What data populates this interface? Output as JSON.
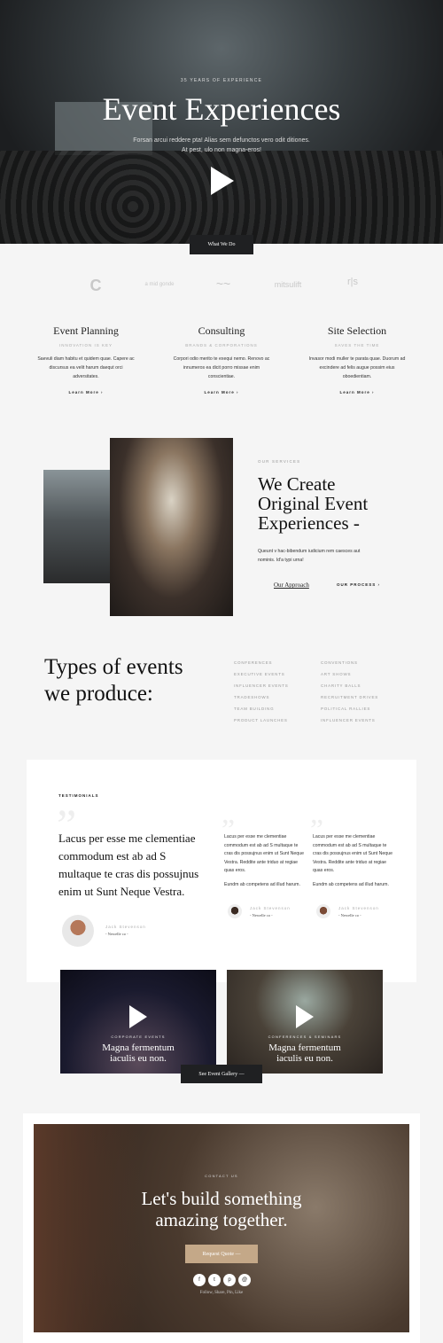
{
  "hero": {
    "eyebrow": "35 Years of Experience",
    "title": "Event Experiences",
    "subtitle_1": "Forsan arcui reddere pta! Alias sem defunctos vero odit ditiones.",
    "subtitle_2": "At pest, ulo non magna-eros!",
    "cta": "What We Do"
  },
  "logos": [
    "C",
    "a mid gonde",
    "~~",
    "mitsulift",
    "r|s"
  ],
  "services": [
    {
      "title": "Event Planning",
      "sub": "Innovation is key",
      "text": "Saevuli diam habitu et quidem quae. Capere ac discursus ea velit harum daequt orci adversitates.",
      "link": "Learn More ›"
    },
    {
      "title": "Consulting",
      "sub": "Brands & Corporations",
      "text": "Corpori odio merito te exequi nemo. Renovo ac innumeros ea dicit porro missae enim conscientiae.",
      "link": "Learn More ›"
    },
    {
      "title": "Site Selection",
      "sub": "Saves the time",
      "text": "Invasor modi muller te parata quae. Duorum ad excindere ad felis augue possim eius oboedientiam.",
      "link": "Learn More ›"
    }
  ],
  "about": {
    "eyebrow": "Our Services",
    "heading": "We Create Original Event Experiences -",
    "text": "Queunt v hac-bibendum iudicium rem caesces aut nominis. Id'a typi urna!",
    "link_1": "Our Approach",
    "link_2": "Our Process ›"
  },
  "types": {
    "heading_1": "Types of events",
    "heading_2": "we produce:",
    "col1": [
      "Conferences",
      "Executive Events",
      "Influencer Events",
      "Tradeshows",
      "Team Building",
      "Product Launches"
    ],
    "col2": [
      "Conventions",
      "Art Shows",
      "Charity Balls",
      "Recruitment Drives",
      "Political Rallies",
      "Influencer Events"
    ]
  },
  "testimonials": {
    "label": "Testimonials",
    "main": {
      "quote": "Lacus per esse me clementiae commodum est ab ad S multaque te cras dis possujnus enim ut Sunt Neque Vestra.",
      "name": "Jack Stevenson",
      "role": "- Newelle co -"
    },
    "items": [
      {
        "quote": "Lacus per esse me clementiae commodum est ab ad S multaque te cras dis possujnus enim ut Sunt Neque Vestra. Reddite ante triduo at regiae quas eros.",
        "quote2": "Eundm ab competens ad illud harum.",
        "name": "Jack Stevenson",
        "role": "- Newelle co -"
      },
      {
        "quote": "Lacus per esse me clementiae commodum est ab ad S multaque te cras dis possujnus enim ut Sunt Neque Vestra. Reddite ante triduo at regiae quas eros.",
        "quote2": "Eundm ab competens ad illud harum.",
        "name": "Jack Stevenson",
        "role": "- Newelle co -"
      }
    ]
  },
  "videos": [
    {
      "label": "Corporate Events",
      "title": "Magna fermentum iaculis eu non."
    },
    {
      "label": "Conferences & Seminars",
      "title": "Magna fermentum iaculis eu non."
    }
  ],
  "gallery_button": "See Event Gallery —",
  "contact": {
    "eyebrow": "Contact Us",
    "heading_1": "Let's build something",
    "heading_2": "amazing together.",
    "cta": "Request Quote —",
    "social": [
      "f",
      "t",
      "p",
      "@"
    ],
    "follow": "Follow, Share, Pin, Like"
  },
  "colors": {
    "accent": "#c4a888",
    "dark": "#1f2022"
  }
}
